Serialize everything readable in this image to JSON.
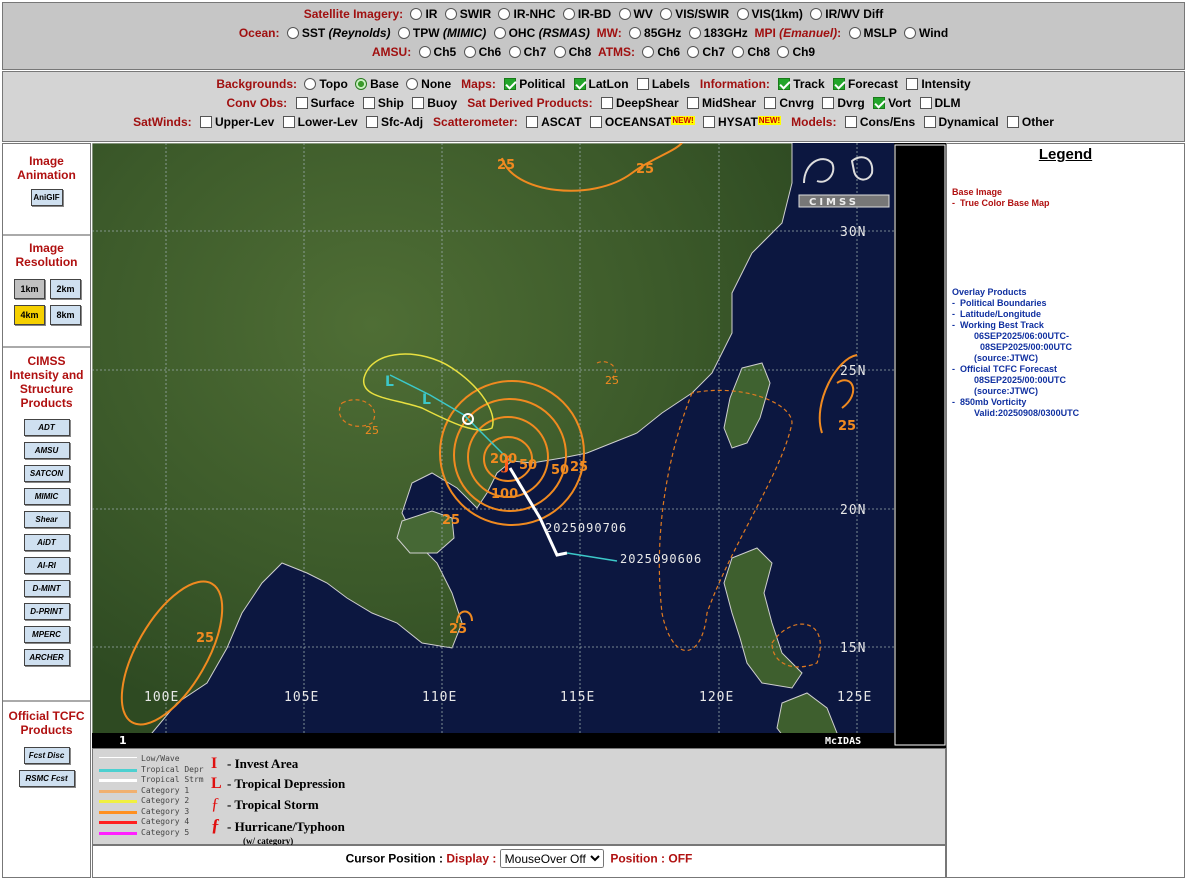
{
  "top": {
    "row1": {
      "label": "Satellite Imagery:",
      "options": [
        "IR",
        "SWIR",
        "IR-NHC",
        "IR-BD",
        "WV",
        "VIS/SWIR",
        "VIS(1km)",
        "IR/WV Diff"
      ]
    },
    "row2": {
      "label": "Ocean:",
      "sst": "SST",
      "sst_src": "(Reynolds)",
      "tpw": "TPW",
      "tpw_src": "(MIMIC)",
      "ohc": "OHC",
      "ohc_src": "(RSMAS)",
      "mw_label": "MW:",
      "mw_opts": [
        "85GHz",
        "183GHz"
      ],
      "mpi_label": "MPI",
      "mpi_src": "(Emanuel)",
      "mpi_colon": ":",
      "mpi_opts": [
        "MSLP",
        "Wind"
      ]
    },
    "row3": {
      "label": "AMSU:",
      "amsu": [
        "Ch5",
        "Ch6",
        "Ch7",
        "Ch8"
      ],
      "atms_label": "ATMS:",
      "atms": [
        "Ch6",
        "Ch7",
        "Ch8",
        "Ch9"
      ]
    }
  },
  "overlays": {
    "backgrounds_label": "Backgrounds:",
    "backgrounds": [
      "Topo",
      "Base",
      "None"
    ],
    "maps_label": "Maps:",
    "maps": [
      "Political",
      "LatLon",
      "Labels"
    ],
    "info_label": "Information:",
    "info": [
      "Track",
      "Forecast",
      "Intensity"
    ],
    "conv_label": "Conv Obs:",
    "conv": [
      "Surface",
      "Ship",
      "Buoy"
    ],
    "sat_label": "Sat Derived Products:",
    "sat": [
      "DeepShear",
      "MidShear",
      "Cnvrg",
      "Dvrg",
      "Vort",
      "DLM"
    ],
    "satwinds_label": "SatWinds:",
    "satwinds": [
      "Upper-Lev",
      "Lower-Lev",
      "Sfc-Adj"
    ],
    "scat_label": "Scatterometer:",
    "scat": [
      "ASCAT",
      "OCEANSAT",
      "HYSAT"
    ],
    "new_badge": "NEW!",
    "models_label": "Models:",
    "models": [
      "Cons/Ens",
      "Dynamical",
      "Other"
    ]
  },
  "left": {
    "animation_title": "Image Animation",
    "anigif": "AniGIF",
    "resolution_title": "Image Resolution",
    "res": [
      "1km",
      "2km",
      "4km",
      "8km"
    ],
    "res_selected": "4km",
    "cimss_title": "CIMSS Intensity and Structure Products",
    "products": [
      "ADT",
      "AMSU",
      "SATCON",
      "MIMIC",
      "Shear",
      "AiDT",
      "AI-RI",
      "D-MINT",
      "D-PRINT",
      "MPERC",
      "ARCHER"
    ],
    "tcfc_title": "Official TCFC Products",
    "tcfc": [
      "Fcst Disc",
      "RSMC Fcst"
    ]
  },
  "map": {
    "lat_labels": [
      "30N",
      "25N",
      "20N",
      "15N"
    ],
    "lon_labels": [
      "100E",
      "105E",
      "110E",
      "115E",
      "120E",
      "125E"
    ],
    "track_labels": [
      "2025090706",
      "2025090606"
    ],
    "contours": [
      "25",
      "25",
      "25",
      "25",
      "25",
      "25",
      "25",
      "25",
      "25",
      "50",
      "50",
      "100",
      "200"
    ],
    "frame_number": "1",
    "mcidas": "McIDAS",
    "logo": "CIMSS"
  },
  "key": {
    "track_types": [
      "Low/Wave",
      "Tropical Depr",
      "Tropical Strm",
      "Category 1",
      "Category 2",
      "Category 3",
      "Category 4",
      "Category 5"
    ],
    "track_colors": [
      "#ffffff",
      "#4dd0d0",
      "#ffffff",
      "#f0b070",
      "#f0f040",
      "#ff9020",
      "#ff2020",
      "#ff20ff"
    ],
    "symbols": [
      {
        "glyph": "I",
        "label": "- Invest Area"
      },
      {
        "glyph": "L",
        "label": "- Tropical Depression"
      },
      {
        "glyph": "ƒ",
        "label": "- Tropical Storm"
      },
      {
        "glyph": "ƒ",
        "label": "- Hurricane/Typhoon"
      }
    ],
    "wcat": "(w/ category)"
  },
  "cursor": {
    "label": "Cursor Position :",
    "display_label": "Display :",
    "display_value": "MouseOver Off",
    "position_label": "Position :",
    "position_value": "OFF"
  },
  "legend": {
    "title": "Legend",
    "base_title": "Base Image",
    "base_item": "-  True Color Base Map",
    "overlay_title": "Overlay Products",
    "items": [
      "-  Political Boundaries",
      "-  Latitude/Longitude",
      "-  Working Best Track",
      "06SEP2025/06:00UTC-",
      "08SEP2025/00:00UTC",
      "(source:JTWC)",
      "-  Official TCFC Forecast",
      "08SEP2025/00:00UTC",
      "(source:JTWC)",
      "-  850mb Vorticity",
      "Valid:20250908/0300UTC"
    ]
  }
}
